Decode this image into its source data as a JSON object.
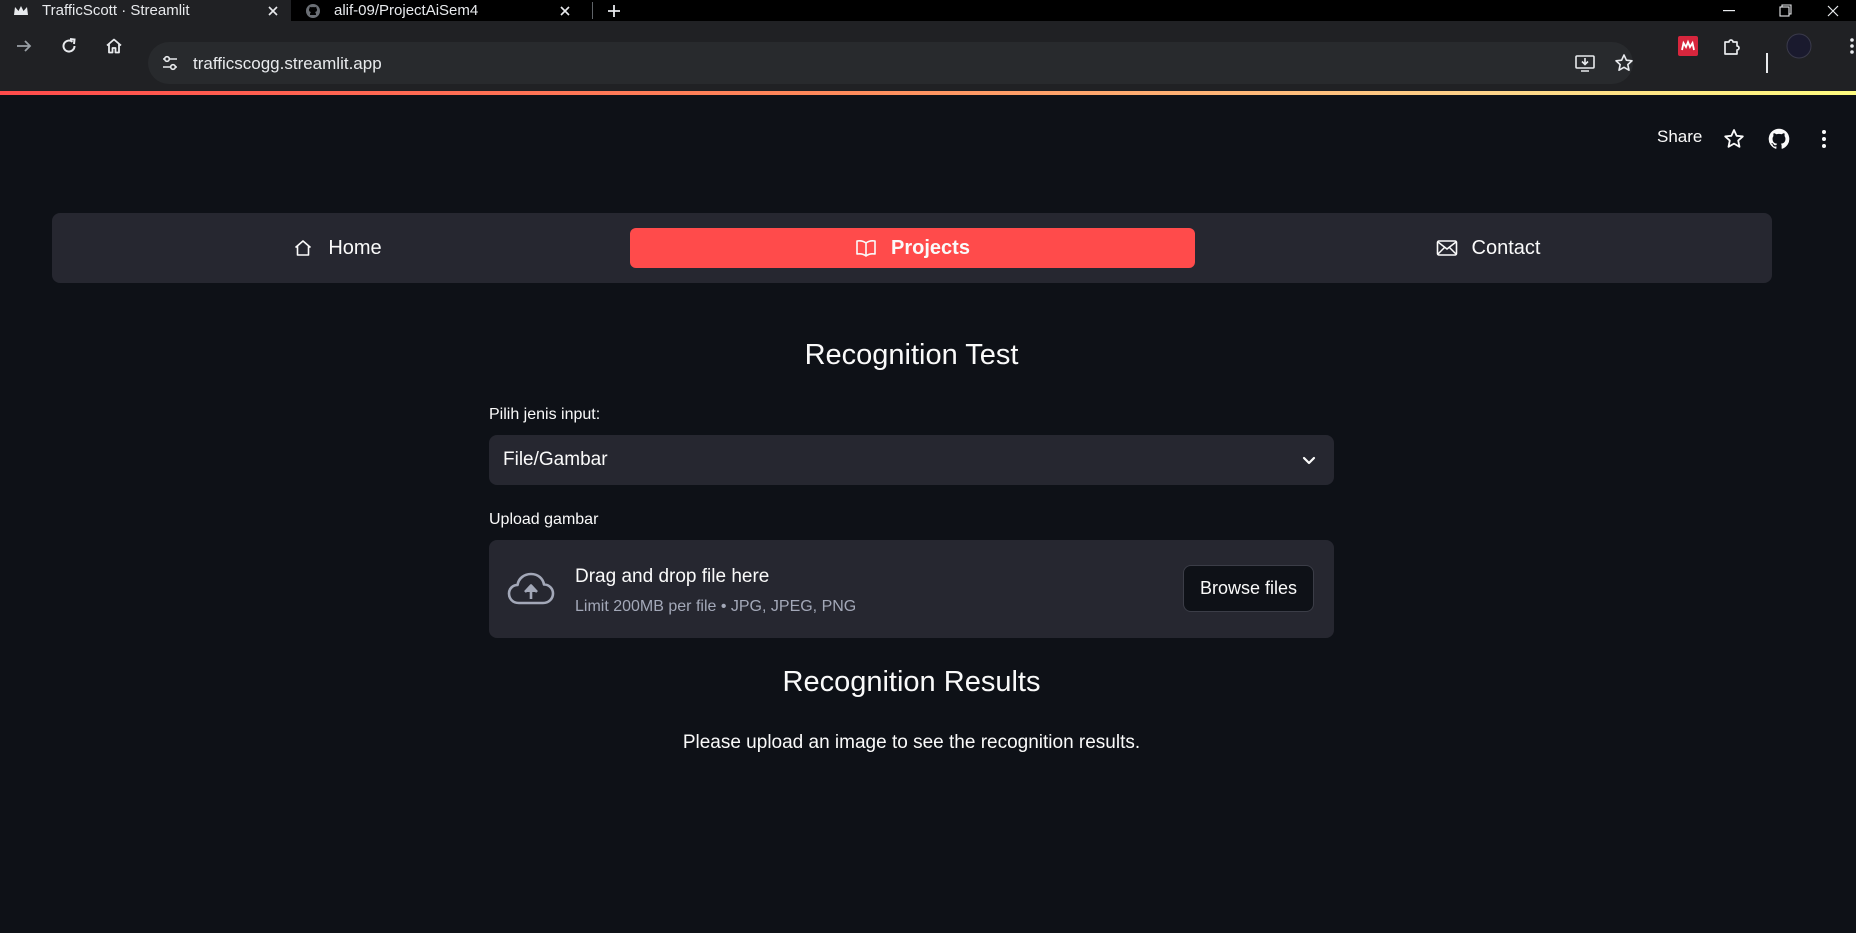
{
  "browser": {
    "tabs": [
      {
        "title": "TrafficScott · Streamlit",
        "favicon": "streamlit-crown-icon",
        "active": true
      },
      {
        "title": "alif-09/ProjectAiSem4",
        "favicon": "github-icon",
        "active": false
      }
    ],
    "url": "trafficscogg.streamlit.app",
    "new_tab_label": "+"
  },
  "header": {
    "share_label": "Share",
    "icons": [
      "star-icon",
      "github-icon",
      "more-vertical-icon"
    ]
  },
  "nav": {
    "items": [
      {
        "label": "Home",
        "icon": "house-icon",
        "active": false
      },
      {
        "label": "Projects",
        "icon": "book-icon",
        "active": true
      },
      {
        "label": "Contact",
        "icon": "envelope-icon",
        "active": false
      }
    ],
    "active_color": "#ff4b4b"
  },
  "main": {
    "title": "Recognition Test",
    "input_type": {
      "label": "Pilih jenis input:",
      "selected": "File/Gambar"
    },
    "upload": {
      "label": "Upload gambar",
      "drop_text": "Drag and drop file here",
      "limit_text": "Limit 200MB per file • JPG, JPEG, PNG",
      "browse_label": "Browse files"
    },
    "results": {
      "title": "Recognition Results",
      "message": "Please upload an image to see the recognition results."
    }
  },
  "colors": {
    "background": "#0e1117",
    "surface": "#262730",
    "accent": "#ff4b4b",
    "muted_text": "#a3a8b8"
  }
}
